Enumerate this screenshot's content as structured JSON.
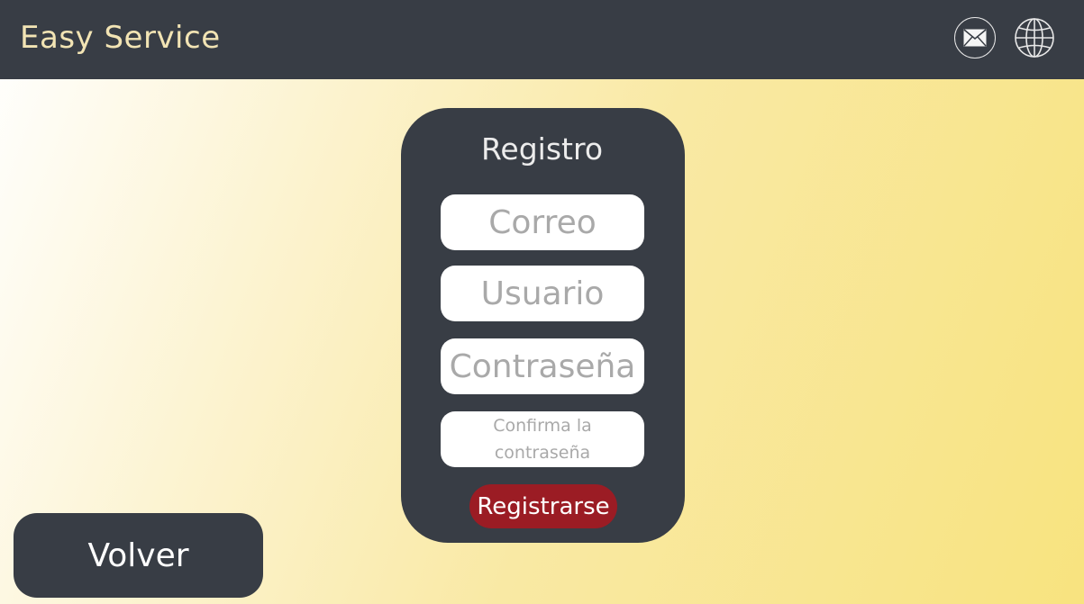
{
  "header": {
    "brand": "Easy Service",
    "icons": [
      "mail-icon",
      "globe-icon"
    ]
  },
  "form": {
    "title": "Registro",
    "fields": {
      "email_placeholder": "Correo",
      "username_placeholder": "Usuario",
      "password_placeholder": "Contraseña",
      "confirm_password_placeholder": "Confirma la contraseña"
    },
    "submit_label": "Registrarse"
  },
  "back_label": "Volver",
  "colors": {
    "dark": "#383d45",
    "brand_text": "#f2e4b4",
    "submit": "#9b1c24",
    "background_start": "#ffffff",
    "background_end": "#f8e37f"
  }
}
